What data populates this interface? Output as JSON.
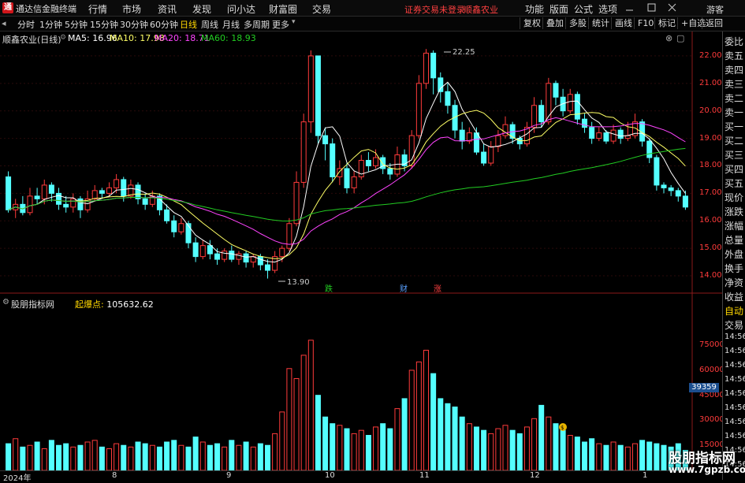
{
  "app": {
    "name": "通达信金融终端",
    "logo": "通",
    "login_notice": "证券交易未登录",
    "stock_name": "顺鑫农业",
    "guest": "游客"
  },
  "menu": [
    "行情",
    "市场",
    "资讯",
    "发现",
    "问小达",
    "财富圈",
    "交易"
  ],
  "right_menu": [
    "功能",
    "版面",
    "公式",
    "选项"
  ],
  "window_icons": [
    "minimize-icon",
    "maximize-icon",
    "close-icon"
  ],
  "toolbar": {
    "periods": [
      "分时",
      "1分钟",
      "5分钟",
      "15分钟",
      "30分钟",
      "60分钟",
      "日线",
      "周线",
      "月线",
      "多周期",
      "更多"
    ],
    "active_period": "日线",
    "right_buttons": [
      "复权",
      "叠加",
      "多股",
      "统计",
      "画线",
      "F10",
      "标记",
      "+自选",
      "返回"
    ]
  },
  "chart_header": {
    "title": "顺鑫农业(日线)",
    "ma5_label": "MA5: 16.96",
    "ma10_label": "MA10: 17.98",
    "ma20_label": "MA20: 18.71",
    "ma60_label": "MA60: 18.93",
    "colors": {
      "ma5": "#ffffff",
      "ma10": "#ffff66",
      "ma20": "#ff44ff",
      "ma60": "#22cc22"
    }
  },
  "annotations": {
    "high_label": "22.25",
    "low_label": "13.90",
    "marker_die": "跌",
    "marker_cai": "财",
    "marker_zhang": "涨"
  },
  "indicator": {
    "title": "股朋指标网",
    "label": "起爆点:",
    "value": "105632.62",
    "volume_badge": "39359"
  },
  "side_panel": [
    "委比",
    "卖五",
    "卖四",
    "卖三",
    "卖二",
    "卖一",
    "买一",
    "买二",
    "买三",
    "买四",
    "买五",
    "现价",
    "涨跌",
    "涨幅",
    "总量",
    "外盘",
    "换手",
    "净资",
    "收益",
    "自动",
    "交易",
    "14:56",
    "14:56",
    "14:56",
    "14:56",
    "14:56",
    "14:56",
    "14:56",
    "14:56",
    "14:56",
    "14:56"
  ],
  "watermark": {
    "line1": "股朋指标网",
    "line2": "www.7gpzb.com"
  },
  "x_axis": [
    "2024年",
    "8",
    "9",
    "10",
    "11",
    "12",
    "1"
  ],
  "chart_data": {
    "type": "candlestick",
    "price_axis": {
      "ticks": [
        "22.00",
        "21.00",
        "20.00",
        "19.00",
        "18.00",
        "17.00",
        "16.00",
        "15.00",
        "14.00"
      ],
      "ylim": [
        13.6,
        22.6
      ]
    },
    "volume_axis": {
      "ticks": [
        "75000",
        "60000",
        "45000",
        "30000",
        "15000"
      ],
      "ylim": [
        0,
        93000
      ]
    },
    "candles": [
      [
        17.6,
        16.4,
        17.8,
        16.3
      ],
      [
        16.4,
        16.6,
        16.8,
        16.1
      ],
      [
        16.6,
        16.3,
        16.9,
        16.2
      ],
      [
        16.3,
        16.9,
        17.2,
        16.2
      ],
      [
        16.9,
        16.8,
        17.2,
        16.6
      ],
      [
        16.8,
        17.3,
        17.5,
        16.6
      ],
      [
        17.3,
        17.0,
        17.4,
        16.7
      ],
      [
        17.0,
        16.6,
        17.2,
        16.4
      ],
      [
        16.6,
        16.5,
        16.9,
        16.3
      ],
      [
        16.5,
        16.8,
        17.0,
        16.3
      ],
      [
        16.8,
        16.4,
        16.9,
        16.1
      ],
      [
        16.4,
        16.8,
        17.1,
        16.3
      ],
      [
        16.8,
        17.1,
        17.3,
        16.7
      ],
      [
        17.1,
        17.0,
        17.2,
        16.8
      ],
      [
        17.0,
        17.2,
        17.4,
        16.9
      ],
      [
        17.2,
        17.5,
        17.7,
        17.0
      ],
      [
        17.5,
        16.9,
        17.6,
        16.7
      ],
      [
        16.9,
        17.3,
        17.5,
        16.8
      ],
      [
        17.3,
        16.8,
        17.4,
        16.6
      ],
      [
        16.8,
        16.6,
        17.0,
        16.4
      ],
      [
        16.6,
        16.9,
        17.1,
        16.5
      ],
      [
        16.9,
        16.4,
        17.0,
        16.2
      ],
      [
        16.4,
        16.0,
        16.6,
        15.9
      ],
      [
        16.0,
        15.6,
        16.2,
        15.4
      ],
      [
        15.6,
        15.9,
        16.1,
        15.5
      ],
      [
        15.9,
        15.2,
        16.0,
        15.0
      ],
      [
        15.2,
        14.7,
        15.4,
        14.5
      ],
      [
        14.7,
        15.1,
        15.3,
        14.6
      ],
      [
        15.1,
        14.8,
        15.3,
        14.6
      ],
      [
        14.8,
        14.6,
        15.0,
        14.4
      ],
      [
        14.6,
        14.9,
        15.0,
        14.5
      ],
      [
        14.9,
        14.6,
        15.1,
        14.5
      ],
      [
        14.6,
        14.8,
        14.9,
        14.4
      ],
      [
        14.8,
        14.5,
        14.9,
        14.3
      ],
      [
        14.5,
        14.7,
        14.8,
        14.3
      ],
      [
        14.7,
        14.4,
        14.8,
        14.2
      ],
      [
        14.4,
        14.2,
        14.6,
        13.9
      ],
      [
        14.2,
        14.7,
        14.9,
        14.1
      ],
      [
        14.7,
        15.0,
        15.1,
        14.5
      ],
      [
        15.0,
        15.9,
        16.1,
        14.9
      ],
      [
        15.9,
        17.4,
        17.8,
        15.8
      ],
      [
        17.4,
        19.6,
        19.9,
        17.2
      ],
      [
        19.6,
        22.0,
        22.2,
        19.2
      ],
      [
        22.0,
        19.1,
        22.0,
        18.8
      ],
      [
        19.1,
        18.8,
        19.4,
        18.2
      ],
      [
        18.8,
        17.6,
        19.0,
        17.4
      ],
      [
        17.6,
        17.9,
        18.2,
        17.3
      ],
      [
        17.9,
        17.2,
        18.1,
        17.0
      ],
      [
        17.2,
        17.6,
        17.8,
        17.0
      ],
      [
        17.6,
        18.2,
        18.4,
        17.5
      ],
      [
        18.2,
        18.0,
        18.5,
        17.8
      ],
      [
        18.0,
        18.3,
        18.6,
        17.9
      ],
      [
        18.3,
        17.9,
        18.4,
        17.7
      ],
      [
        17.9,
        17.7,
        18.1,
        17.5
      ],
      [
        17.7,
        18.4,
        18.7,
        17.6
      ],
      [
        18.4,
        18.0,
        18.6,
        17.8
      ],
      [
        18.0,
        19.1,
        19.3,
        17.9
      ],
      [
        19.1,
        21.0,
        21.3,
        19.0
      ],
      [
        21.0,
        22.1,
        22.25,
        20.8
      ],
      [
        22.1,
        21.2,
        22.2,
        20.6
      ],
      [
        21.2,
        20.7,
        21.4,
        20.3
      ],
      [
        20.7,
        20.2,
        21.0,
        19.9
      ],
      [
        20.2,
        19.3,
        20.4,
        19.0
      ],
      [
        19.3,
        18.9,
        19.6,
        18.6
      ],
      [
        18.9,
        19.2,
        19.4,
        18.8
      ],
      [
        19.2,
        18.5,
        19.4,
        18.4
      ],
      [
        18.5,
        18.1,
        18.8,
        18.0
      ],
      [
        18.1,
        18.7,
        18.9,
        18.0
      ],
      [
        18.7,
        19.1,
        19.3,
        18.5
      ],
      [
        19.1,
        19.5,
        19.8,
        19.0
      ],
      [
        19.5,
        19.0,
        19.6,
        18.8
      ],
      [
        19.0,
        18.8,
        19.1,
        18.6
      ],
      [
        18.8,
        19.4,
        19.6,
        18.7
      ],
      [
        19.4,
        20.2,
        20.5,
        19.2
      ],
      [
        20.2,
        19.6,
        20.4,
        19.4
      ],
      [
        19.6,
        21.0,
        21.2,
        19.5
      ],
      [
        21.0,
        20.5,
        21.1,
        20.2
      ],
      [
        20.5,
        20.0,
        20.8,
        19.8
      ],
      [
        20.0,
        20.6,
        20.8,
        19.9
      ],
      [
        20.6,
        19.7,
        20.7,
        19.5
      ],
      [
        19.7,
        19.4,
        19.9,
        19.2
      ],
      [
        19.4,
        19.0,
        19.6,
        18.8
      ],
      [
        19.0,
        19.2,
        19.4,
        18.9
      ],
      [
        19.2,
        18.9,
        19.3,
        18.8
      ],
      [
        18.9,
        19.3,
        19.5,
        18.8
      ],
      [
        19.3,
        19.0,
        19.4,
        18.8
      ],
      [
        19.0,
        19.1,
        19.6,
        18.9
      ],
      [
        19.1,
        19.6,
        19.9,
        19.0
      ],
      [
        19.6,
        18.9,
        19.7,
        18.7
      ],
      [
        18.9,
        18.3,
        19.0,
        18.1
      ],
      [
        18.3,
        17.3,
        18.4,
        17.1
      ],
      [
        17.3,
        17.2,
        17.4,
        17.0
      ],
      [
        17.2,
        17.1,
        17.3,
        16.9
      ],
      [
        17.1,
        16.9,
        17.2,
        16.7
      ],
      [
        16.9,
        16.5,
        17.1,
        16.4
      ]
    ],
    "volumes": [
      16000,
      19000,
      14000,
      15000,
      17000,
      13000,
      18000,
      15000,
      16000,
      14000,
      15000,
      17000,
      18000,
      14000,
      13000,
      16000,
      15000,
      14000,
      17000,
      16000,
      15000,
      14000,
      17000,
      18000,
      15000,
      14000,
      20000,
      17000,
      15000,
      16000,
      14000,
      18000,
      15000,
      17000,
      14000,
      16000,
      15000,
      22000,
      35000,
      61000,
      55000,
      69000,
      78000,
      45000,
      32000,
      28000,
      27000,
      25000,
      22000,
      24000,
      21000,
      26000,
      28000,
      25000,
      37000,
      43000,
      60000,
      65000,
      72000,
      58000,
      43000,
      40000,
      38000,
      32000,
      28000,
      26000,
      24000,
      22000,
      25000,
      27000,
      24000,
      22000,
      26000,
      31000,
      39000,
      32000,
      28000,
      24000,
      21000,
      20000,
      17000,
      19000,
      16000,
      15000,
      17000,
      15000,
      14000,
      16000,
      18000,
      17000,
      16000,
      15000,
      14000,
      16000,
      12000
    ]
  }
}
